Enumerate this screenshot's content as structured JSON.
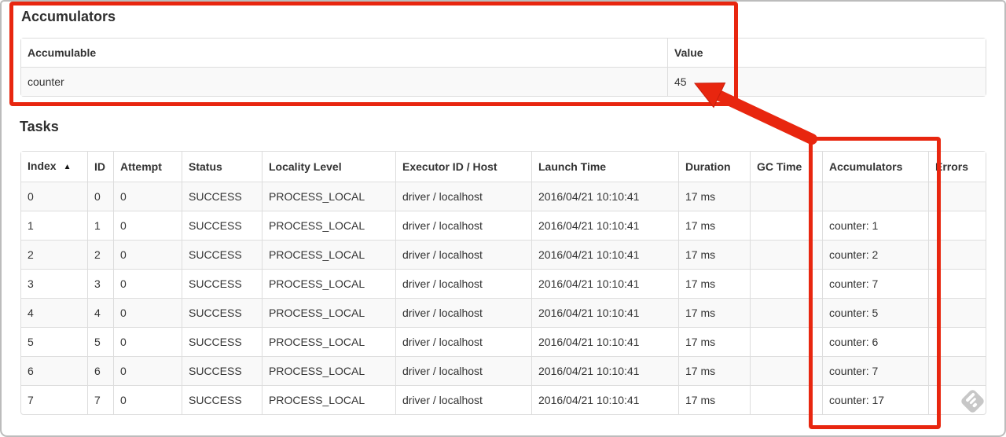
{
  "accumulators_section": {
    "title": "Accumulators",
    "table": {
      "columns": [
        {
          "key": "accumulable",
          "label": "Accumulable"
        },
        {
          "key": "value",
          "label": "Value"
        }
      ],
      "rows": [
        {
          "accumulable": "counter",
          "value": "45"
        }
      ]
    }
  },
  "tasks_section": {
    "title": "Tasks",
    "table": {
      "sort_icon": "▲",
      "columns": [
        {
          "key": "index",
          "label": "Index"
        },
        {
          "key": "id",
          "label": "ID"
        },
        {
          "key": "attempt",
          "label": "Attempt"
        },
        {
          "key": "status",
          "label": "Status"
        },
        {
          "key": "locality",
          "label": "Locality Level"
        },
        {
          "key": "executor",
          "label": "Executor ID / Host"
        },
        {
          "key": "launch",
          "label": "Launch Time"
        },
        {
          "key": "duration",
          "label": "Duration"
        },
        {
          "key": "gc_time",
          "label": "GC Time"
        },
        {
          "key": "accumulators",
          "label": "Accumulators"
        },
        {
          "key": "errors",
          "label": "Errors"
        }
      ],
      "rows": [
        {
          "index": "0",
          "id": "0",
          "attempt": "0",
          "status": "SUCCESS",
          "locality": "PROCESS_LOCAL",
          "executor": "driver / localhost",
          "launch": "2016/04/21 10:10:41",
          "duration": "17 ms",
          "gc_time": "",
          "accumulators": "",
          "errors": ""
        },
        {
          "index": "1",
          "id": "1",
          "attempt": "0",
          "status": "SUCCESS",
          "locality": "PROCESS_LOCAL",
          "executor": "driver / localhost",
          "launch": "2016/04/21 10:10:41",
          "duration": "17 ms",
          "gc_time": "",
          "accumulators": "counter: 1",
          "errors": ""
        },
        {
          "index": "2",
          "id": "2",
          "attempt": "0",
          "status": "SUCCESS",
          "locality": "PROCESS_LOCAL",
          "executor": "driver / localhost",
          "launch": "2016/04/21 10:10:41",
          "duration": "17 ms",
          "gc_time": "",
          "accumulators": "counter: 2",
          "errors": ""
        },
        {
          "index": "3",
          "id": "3",
          "attempt": "0",
          "status": "SUCCESS",
          "locality": "PROCESS_LOCAL",
          "executor": "driver / localhost",
          "launch": "2016/04/21 10:10:41",
          "duration": "17 ms",
          "gc_time": "",
          "accumulators": "counter: 7",
          "errors": ""
        },
        {
          "index": "4",
          "id": "4",
          "attempt": "0",
          "status": "SUCCESS",
          "locality": "PROCESS_LOCAL",
          "executor": "driver / localhost",
          "launch": "2016/04/21 10:10:41",
          "duration": "17 ms",
          "gc_time": "",
          "accumulators": "counter: 5",
          "errors": ""
        },
        {
          "index": "5",
          "id": "5",
          "attempt": "0",
          "status": "SUCCESS",
          "locality": "PROCESS_LOCAL",
          "executor": "driver / localhost",
          "launch": "2016/04/21 10:10:41",
          "duration": "17 ms",
          "gc_time": "",
          "accumulators": "counter: 6",
          "errors": ""
        },
        {
          "index": "6",
          "id": "6",
          "attempt": "0",
          "status": "SUCCESS",
          "locality": "PROCESS_LOCAL",
          "executor": "driver / localhost",
          "launch": "2016/04/21 10:10:41",
          "duration": "17 ms",
          "gc_time": "",
          "accumulators": "counter: 7",
          "errors": ""
        },
        {
          "index": "7",
          "id": "7",
          "attempt": "0",
          "status": "SUCCESS",
          "locality": "PROCESS_LOCAL",
          "executor": "driver / localhost",
          "launch": "2016/04/21 10:10:41",
          "duration": "17 ms",
          "gc_time": "",
          "accumulators": "counter: 17",
          "errors": ""
        }
      ]
    }
  },
  "annotations": {
    "highlight_color": "#e8260f"
  }
}
